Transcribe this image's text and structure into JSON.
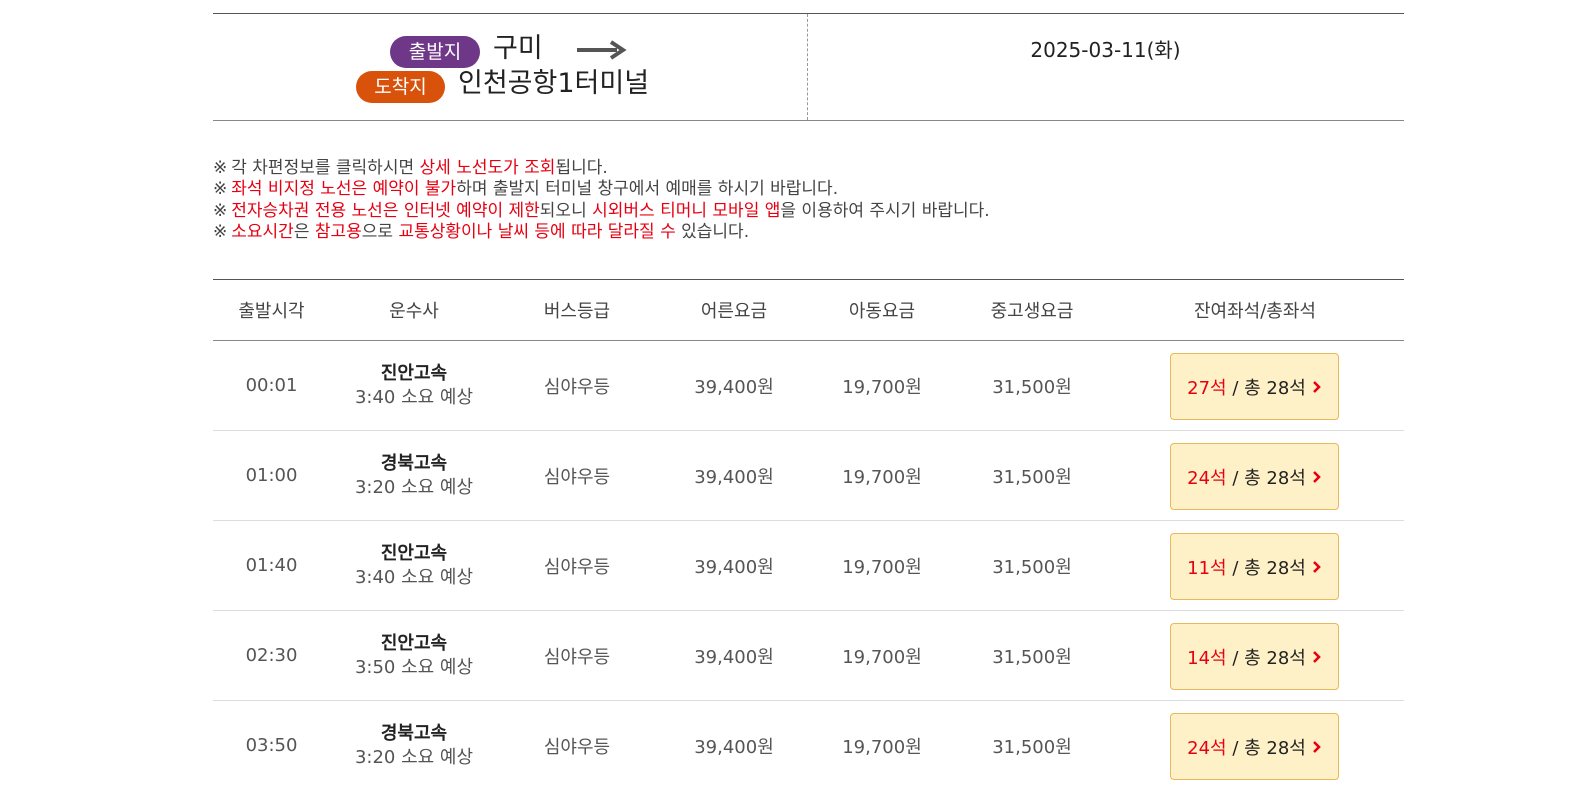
{
  "route": {
    "departure_badge": "출발지",
    "departure": "구미",
    "arrival_badge": "도착지",
    "arrival": "인천공항1터미널",
    "date": "2025-03-11(화)"
  },
  "notices": [
    {
      "mark": "※",
      "parts": [
        [
          "각 차편정보를 클릭하시면 ",
          false
        ],
        [
          "상세 노선도가 조회",
          true
        ],
        [
          "됩니다.",
          false
        ]
      ]
    },
    {
      "mark": "※",
      "parts": [
        [
          "좌석 비지정 노선은 예약이 불가",
          true
        ],
        [
          "하며 출발지 터미널 창구에서 예매를 하시기 바랍니다.",
          false
        ]
      ]
    },
    {
      "mark": "※",
      "parts": [
        [
          "전자승차권 전용 노선은 인터넷 예약이 제한",
          true
        ],
        [
          "되오니 ",
          false
        ],
        [
          "시외버스 티머니 모바일 앱",
          true
        ],
        [
          "을 이용하여 주시기 바랍니다.",
          false
        ]
      ]
    },
    {
      "mark": "※",
      "parts": [
        [
          "소요시간",
          true
        ],
        [
          "은 ",
          false
        ],
        [
          "참고용",
          true
        ],
        [
          "으로 ",
          false
        ],
        [
          "교통상황이나 날씨 등에 따라 달라질 수",
          true
        ],
        [
          " 있습니다.",
          false
        ]
      ]
    }
  ],
  "table": {
    "headers": [
      "출발시각",
      "운수사",
      "버스등급",
      "어른요금",
      "아동요금",
      "중고생요금",
      "잔여좌석/총좌석"
    ],
    "rows": [
      {
        "time": "00:01",
        "company": "진안고속",
        "duration": "3:40 소요 예상",
        "grade": "심야우등",
        "adult": "39,400원",
        "child": "19,700원",
        "student": "31,500원",
        "remain": "27석",
        "total": " / 총 28석"
      },
      {
        "time": "01:00",
        "company": "경북고속",
        "duration": "3:20 소요 예상",
        "grade": "심야우등",
        "adult": "39,400원",
        "child": "19,700원",
        "student": "31,500원",
        "remain": "24석",
        "total": " / 총 28석"
      },
      {
        "time": "01:40",
        "company": "진안고속",
        "duration": "3:40 소요 예상",
        "grade": "심야우등",
        "adult": "39,400원",
        "child": "19,700원",
        "student": "31,500원",
        "remain": "11석",
        "total": " / 총 28석"
      },
      {
        "time": "02:30",
        "company": "진안고속",
        "duration": "3:50 소요 예상",
        "grade": "심야우등",
        "adult": "39,400원",
        "child": "19,700원",
        "student": "31,500원",
        "remain": "14석",
        "total": " / 총 28석"
      },
      {
        "time": "03:50",
        "company": "경북고속",
        "duration": "3:20 소요 예상",
        "grade": "심야우등",
        "adult": "39,400원",
        "child": "19,700원",
        "student": "31,500원",
        "remain": "24석",
        "total": " / 총 28석"
      }
    ]
  },
  "colors": {
    "departure_badge": "#6f3787",
    "arrival_badge": "#d8520c",
    "highlight": "#e60012",
    "seat_button": "#fff1c7"
  },
  "icons": {
    "route_arrow": "arrow-right-icon",
    "seat_chevron": "chevron-right-icon"
  }
}
